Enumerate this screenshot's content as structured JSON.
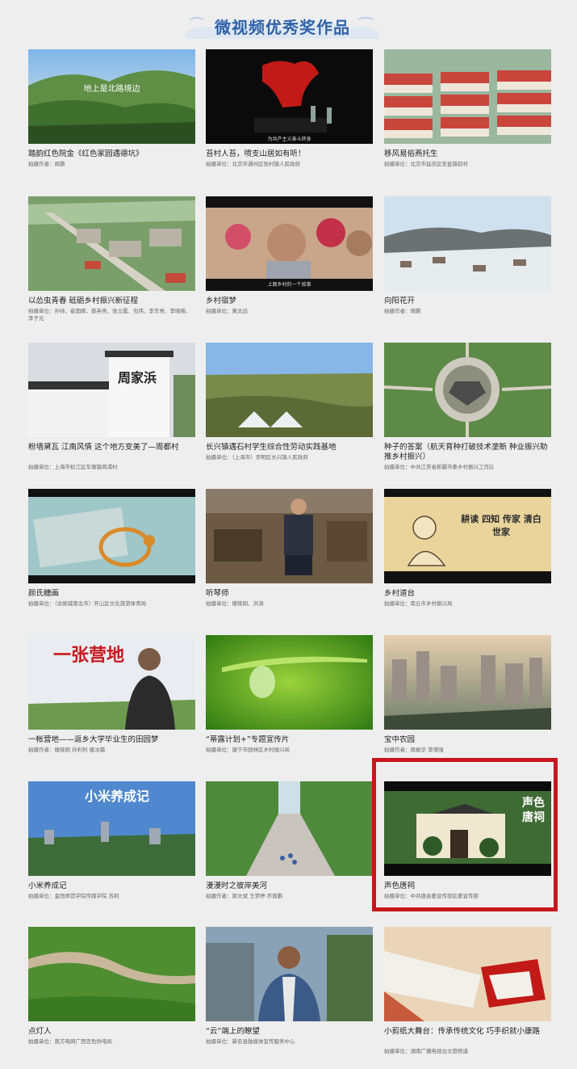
{
  "header": {
    "title": "微视频优秀奖作品"
  },
  "cards": [
    {
      "title": "踏韵红色院金《红色家园遇德坑》",
      "unit": "拍摄作者：周鹏",
      "thumb_text": "地上是北路境边"
    },
    {
      "title": "苔村人苔，喷支山居如有听！",
      "unit": "拍摄单位：北京市通州区张村镇人民政府",
      "thumb_text": "为共产主义奋斗终身"
    },
    {
      "title": "移风易俗燕托生",
      "unit": "拍摄单位：北京市延庆区安盆镇前村"
    },
    {
      "title": "以怂虫青春 砥砺乡村振兴新征程",
      "unit": "拍摄单位：孙帅、崔国辉、蔡英亮、张立霞、包伟、李东亮、李晓楠、李子元"
    },
    {
      "title": "乡村宿梦",
      "unit": "拍摄单位：黄文远",
      "thumb_text": "上面乡村的一个故事"
    },
    {
      "title": "向阳花开",
      "unit": "拍摄作者：周鹏"
    },
    {
      "title": "粉墙黛瓦 江南风情 这个地方变美了—周都村",
      "unit": "拍摄单位：上海市松江区车墩镇周浦村",
      "thumb_text": "周家浜"
    },
    {
      "title": "长兴镇遇石村学生综合性劳动实践基地",
      "unit": "拍摄单位：（上海市）崇明区长兴镇人民政府"
    },
    {
      "title": "种子的答案（航天育种打破技术垄断 种业振兴助推乡村振兴）",
      "unit": "拍摄单位：中共江苏省新疆市委乡村振兴工作队"
    },
    {
      "title": "颜氏糖画",
      "unit": "拍摄单位：（余姚城南北市）开山区文化旅游体育局"
    },
    {
      "title": "听琴师",
      "unit": "拍摄单位：楼晓刚、洪涛"
    },
    {
      "title": "乡村道台",
      "unit": "拍摄单位：南丘市乡村振兴局",
      "thumb_text": "耕读 四知 传家 清白世家"
    },
    {
      "title": "一帐营地——返乡大学毕业生的田园梦",
      "unit": "拍摄作者：楼晓刚 孙利利 楼冰霜",
      "thumb_text": "一张营地"
    },
    {
      "title": "“蒂露计划+”专题宣传片",
      "unit": "拍摄单位：唐宁市园林区乡村振兴局"
    },
    {
      "title": "宝中农园",
      "unit": "拍摄作者：周振华 李增强"
    },
    {
      "title": "小米养成记",
      "unit": "拍摄单位：金阳师范学院传媒学院 苏利",
      "thumb_text": "小米养成记"
    },
    {
      "title": "漫漫时之彼岸美河",
      "unit": "拍摄作者：郭文斌 王梦婷 乔晋鹏"
    },
    {
      "title": "声色唐祠",
      "unit": "拍摄单位：中共唐县委宣传部区委宣传部",
      "thumb_text": "声色唐祠"
    },
    {
      "title": "点灯人",
      "unit": "拍摄单位：南方电网广西百色供电局"
    },
    {
      "title": "“云”端上的瞭望",
      "unit": "拍摄单位：新安县融媒体宣传服务中心"
    },
    {
      "title": "小剪纸大舞台：传承传统文化 巧手织就小康路",
      "unit": "拍摄单位：湖南广播电视台文旅频道"
    }
  ],
  "colors": {
    "accent": "#2f62a8",
    "highlight_border": "#c8161d",
    "background": "#eeeeef"
  }
}
